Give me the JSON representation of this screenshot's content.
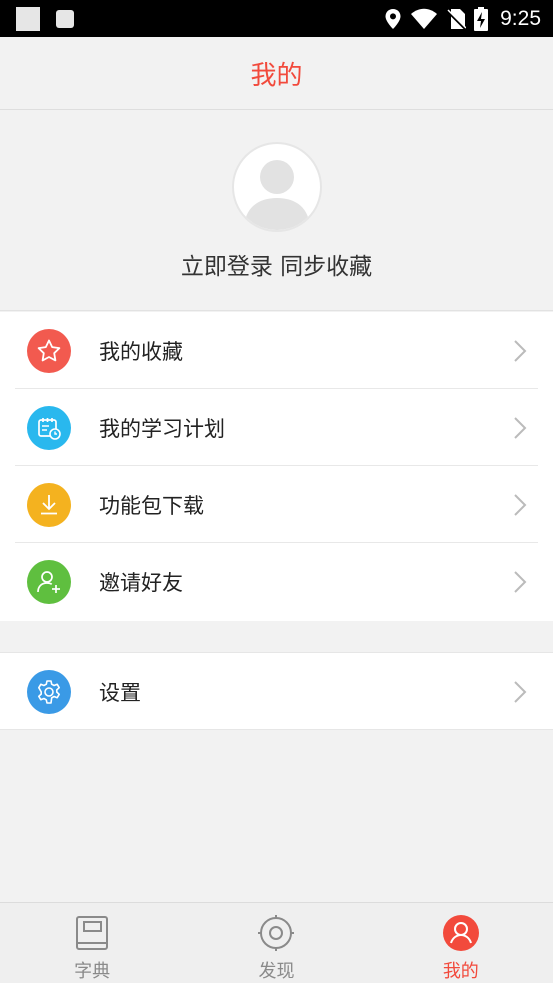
{
  "status_bar": {
    "time": "9:25"
  },
  "header": {
    "title": "我的"
  },
  "profile": {
    "login_text": "立即登录 同步收藏"
  },
  "menu": {
    "items": [
      {
        "label": "我的收藏",
        "icon": "star-icon",
        "color": "#f25a4f"
      },
      {
        "label": "我的学习计划",
        "icon": "calendar-icon",
        "color": "#29b8ee"
      },
      {
        "label": "功能包下载",
        "icon": "download-icon",
        "color": "#f4b21f"
      },
      {
        "label": "邀请好友",
        "icon": "add-user-icon",
        "color": "#5fbf3f"
      }
    ],
    "settings": {
      "label": "设置",
      "icon": "gear-icon",
      "color": "#3a9ae6"
    }
  },
  "tabbar": {
    "tabs": [
      {
        "label": "字典",
        "icon": "book-icon",
        "active": false
      },
      {
        "label": "发现",
        "icon": "compass-icon",
        "active": false
      },
      {
        "label": "我的",
        "icon": "user-icon",
        "active": true
      }
    ]
  },
  "colors": {
    "accent": "#f24a3c",
    "background": "#f2f2f2"
  }
}
